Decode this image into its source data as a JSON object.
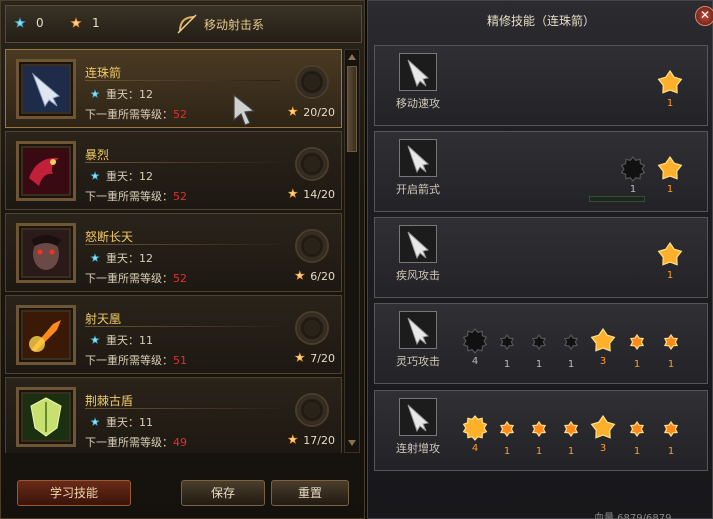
{
  "resources": {
    "blue_value": "0",
    "orange_value": "1",
    "blue_icon": "blue-star-gem-icon",
    "orange_icon": "orange-star-gem-icon"
  },
  "school": {
    "title": "移动射击系",
    "icon": "bow-icon"
  },
  "level_label": "重天：",
  "req_label": "下一重所需等级：",
  "skills": [
    {
      "name": "连珠箭",
      "level": "12",
      "req": "52",
      "progress": "20/20",
      "icon": "arrow-volley-icon",
      "selected": true
    },
    {
      "name": "暴烈",
      "level": "12",
      "req": "52",
      "progress": "14/20",
      "icon": "red-dragon-icon",
      "selected": false
    },
    {
      "name": "怒断长天",
      "level": "12",
      "req": "52",
      "progress": "6/20",
      "icon": "demon-face-icon",
      "selected": false
    },
    {
      "name": "射天凰",
      "level": "11",
      "req": "51",
      "progress": "7/20",
      "icon": "fire-phoenix-icon",
      "selected": false
    },
    {
      "name": "荆棘古盾",
      "level": "11",
      "req": "49",
      "progress": "17/20",
      "icon": "thorn-shield-icon",
      "selected": false
    }
  ],
  "buttons": {
    "learn": "学习技能",
    "save": "保存",
    "reset": "重置"
  },
  "panel": {
    "title": "精修技能（连珠箭）",
    "close_icon": "close-icon"
  },
  "perks": [
    {
      "label": "移动速攻",
      "nodes": [
        {
          "count": "1",
          "type": "star",
          "active": true
        }
      ]
    },
    {
      "label": "开启箭式",
      "nodes": [
        {
          "count": "1",
          "type": "burst",
          "active": false
        },
        {
          "count": "1",
          "type": "star",
          "active": true
        }
      ]
    },
    {
      "label": "疾风攻击",
      "nodes": [
        {
          "count": "1",
          "type": "star",
          "active": true
        }
      ]
    },
    {
      "label": "灵巧攻击",
      "nodes": [
        {
          "count": "4",
          "type": "burst",
          "active": false
        },
        {
          "count": "1",
          "type": "small",
          "active": false
        },
        {
          "count": "1",
          "type": "small",
          "active": false
        },
        {
          "count": "1",
          "type": "small",
          "active": false
        },
        {
          "count": "3",
          "type": "star",
          "active": true
        },
        {
          "count": "1",
          "type": "small",
          "active": true
        },
        {
          "count": "1",
          "type": "small",
          "active": true
        }
      ]
    },
    {
      "label": "连射增攻",
      "nodes": [
        {
          "count": "4",
          "type": "burst",
          "active": true
        },
        {
          "count": "1",
          "type": "small",
          "active": true
        },
        {
          "count": "1",
          "type": "small",
          "active": true
        },
        {
          "count": "1",
          "type": "small",
          "active": true
        },
        {
          "count": "3",
          "type": "star",
          "active": true
        },
        {
          "count": "1",
          "type": "small",
          "active": true
        },
        {
          "count": "1",
          "type": "small",
          "active": true
        }
      ]
    }
  ],
  "status_text": "血量 6879/6879",
  "colors": {
    "accent_gold": "#f0c866",
    "required_red": "#e03030",
    "count_orange": "#ff9a2a"
  }
}
